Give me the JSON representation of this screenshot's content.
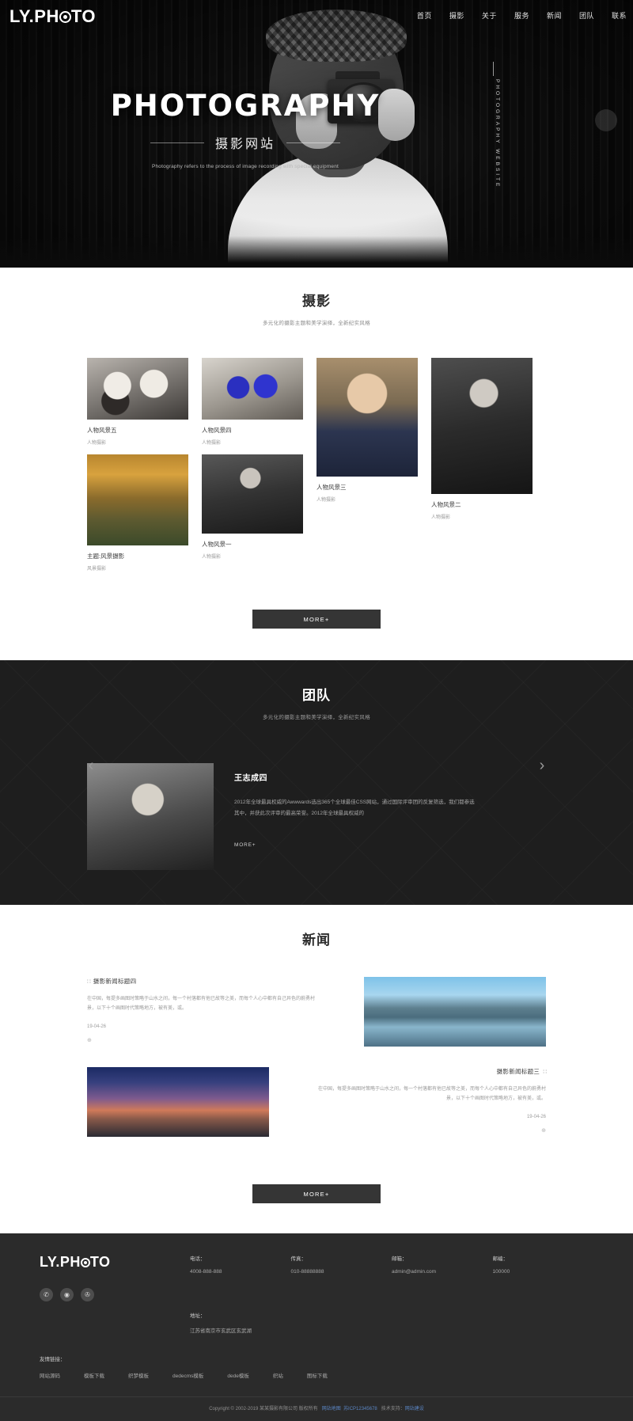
{
  "site": {
    "logo_prefix": "LY.PH",
    "logo_suffix": "TO"
  },
  "nav": {
    "items": [
      {
        "label": "首页"
      },
      {
        "label": "摄影"
      },
      {
        "label": "关于"
      },
      {
        "label": "服务"
      },
      {
        "label": "新闻"
      },
      {
        "label": "团队"
      },
      {
        "label": "联系"
      }
    ]
  },
  "hero": {
    "title": "PHOTOGRAPHY",
    "subtitle": "摄影网站",
    "description": "Photography refers to the process of image recording with special equipment",
    "vertical_text": "PHOTOGRAPHY WEBSITE"
  },
  "photography": {
    "title": "摄影",
    "subtitle": "多元化的摄影主题和美学演绎，全新纪实风格",
    "items": [
      {
        "caption": "人物风景五",
        "category": "人物摄影"
      },
      {
        "caption": "人物风景四",
        "category": "人物摄影"
      },
      {
        "caption": "人物风景三",
        "category": "人物摄影"
      },
      {
        "caption": "人物风景二",
        "category": "人物摄影"
      },
      {
        "caption": "主题:风景摄影",
        "category": "风景摄影"
      },
      {
        "caption": "人物风景一",
        "category": "人物摄影"
      }
    ],
    "more_label": "MORE+"
  },
  "team": {
    "title": "团队",
    "subtitle": "多元化的摄影主题和美学演绎，全新纪实风格",
    "member_name": "王志成四",
    "member_desc": "2012年全球最具权威的Awwwards选出365个全球最佳CSS网站，通过国际评审团的反复筛选，我们都参选其中，并获此次评审的最高荣誉。2012年全球最具权威的",
    "more_label": "MORE+",
    "prev_icon": "chevron-left",
    "next_icon": "chevron-right"
  },
  "news": {
    "title": "新闻",
    "items": [
      {
        "title": "摄影新闻标题四",
        "body": "在中国，每提多画图时策略于山水之间，每一个村落都有他已故等之美，而每个人心中都有自己异色的蔚勇村景，以下十个画图时代策略地方，被有美，或。",
        "date": "19-04-26",
        "plus": "⊕",
        "align": "left",
        "image": "lake"
      },
      {
        "title": "摄影新闻标题三",
        "body": "在中国，每提多画图时策略于山水之间，每一个村落都有他已故等之美，而每个人心中都有自己异色的蔚勇村景，以下十个画图时代策略地方，被有美，或。",
        "date": "19-04-26",
        "plus": "⊕",
        "align": "right",
        "image": "night"
      }
    ],
    "more_label": "MORE+"
  },
  "footer": {
    "logo_prefix": "LY.PH",
    "logo_suffix": "TO",
    "socials": [
      {
        "name": "wechat",
        "glyph": "✆"
      },
      {
        "name": "weibo",
        "glyph": "◉"
      },
      {
        "name": "qq",
        "glyph": "✇"
      }
    ],
    "contacts": [
      {
        "label": "电话：",
        "value": "4008-888-888"
      },
      {
        "label": "传真：",
        "value": "010-88888888"
      },
      {
        "label": "邮箱：",
        "value": "admin@admin.com"
      },
      {
        "label": "邮编：",
        "value": "100000"
      }
    ],
    "address_label": "地址：",
    "address_value": "江苏省南京市玄武区玄武湖",
    "friend_links_label": "友情链接：",
    "friend_links": [
      {
        "label": "网站源码"
      },
      {
        "label": "模板下载"
      },
      {
        "label": "织梦模板"
      },
      {
        "label": "dedecms模板"
      },
      {
        "label": "dede模板"
      },
      {
        "label": "织站"
      },
      {
        "label": "图标下载"
      }
    ],
    "copyright": "Copyright © 2002-2019 某某摄影有限公司 版权所有",
    "icp_label": "网站地图",
    "icp_value": "苏ICP12345678",
    "support_label": "技术支持：",
    "support_value": "网站建设"
  },
  "colors": {
    "dark": "#1e1e1e",
    "footer": "#2b2b2b",
    "button": "#353535",
    "link": "#5b86c4"
  }
}
